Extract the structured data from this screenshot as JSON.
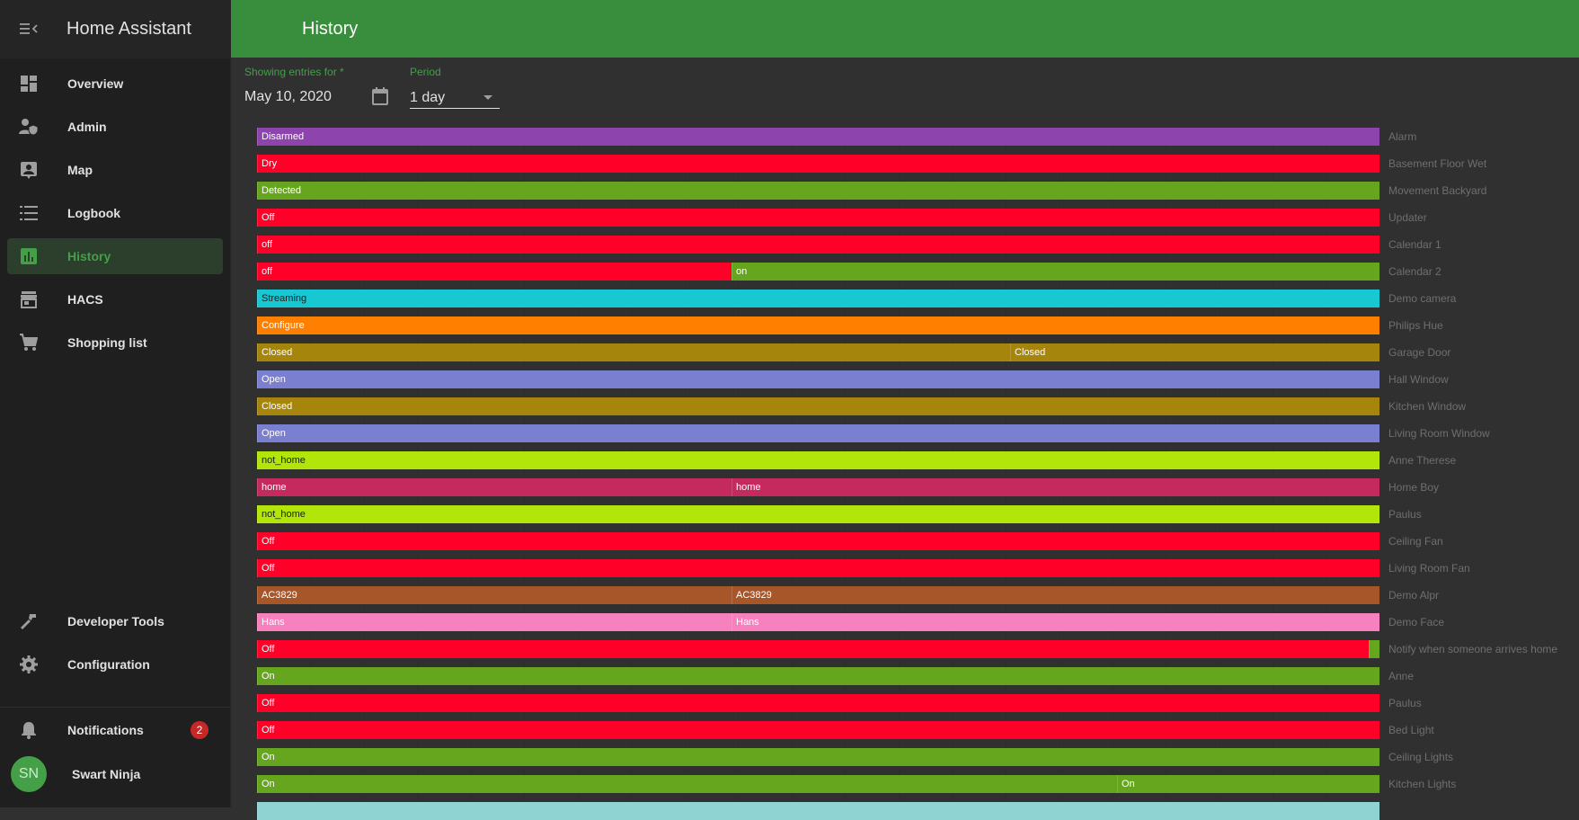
{
  "sidebar": {
    "title": "Home Assistant",
    "items": [
      {
        "label": "Overview",
        "icon": "dashboard-icon"
      },
      {
        "label": "Admin",
        "icon": "account-shield-icon"
      },
      {
        "label": "Map",
        "icon": "account-box-icon"
      },
      {
        "label": "Logbook",
        "icon": "format-list-icon"
      },
      {
        "label": "History",
        "icon": "chart-box-icon",
        "active": true
      },
      {
        "label": "HACS",
        "icon": "store-icon"
      },
      {
        "label": "Shopping list",
        "icon": "cart-icon"
      }
    ],
    "bottom_items": [
      {
        "label": "Developer Tools",
        "icon": "hammer-icon"
      },
      {
        "label": "Configuration",
        "icon": "cog-icon"
      }
    ],
    "notifications": {
      "label": "Notifications",
      "count": "2"
    },
    "user": {
      "initials": "SN",
      "name": "Swart Ninja"
    }
  },
  "header": {
    "title": "History"
  },
  "filters": {
    "date_label": "Showing entries for *",
    "date_value": "May 10, 2020",
    "period_label": "Period",
    "period_value": "1 day"
  },
  "colors": {
    "accent": "#43a047",
    "header": "#388e3c",
    "background": "#303030",
    "sidebar": "#1f1f1f"
  },
  "chart_data": {
    "type": "timeline",
    "rows": [
      {
        "entity": "Alarm",
        "segments": [
          {
            "state": "Disarmed",
            "start": 0,
            "end": 1,
            "color": "#8e44ad"
          }
        ]
      },
      {
        "entity": "Basement Floor Wet",
        "segments": [
          {
            "state": "Dry",
            "start": 0,
            "end": 1,
            "color": "#ff0029"
          }
        ]
      },
      {
        "entity": "Movement Backyard",
        "segments": [
          {
            "state": "Detected",
            "start": 0,
            "end": 1,
            "color": "#66a61e"
          }
        ]
      },
      {
        "entity": "Updater",
        "segments": [
          {
            "state": "Off",
            "start": 0,
            "end": 1,
            "color": "#ff0029"
          }
        ]
      },
      {
        "entity": "Calendar 1",
        "segments": [
          {
            "state": "off",
            "start": 0,
            "end": 1,
            "color": "#ff0029"
          }
        ]
      },
      {
        "entity": "Calendar 2",
        "segments": [
          {
            "state": "off",
            "start": 0,
            "end": 0.423,
            "color": "#ff0029"
          },
          {
            "state": "on",
            "start": 0.423,
            "end": 1,
            "color": "#66a61e"
          }
        ]
      },
      {
        "entity": "Demo camera",
        "segments": [
          {
            "state": "Streaming",
            "start": 0,
            "end": 1,
            "color": "#17c8d3"
          }
        ]
      },
      {
        "entity": "Philips Hue",
        "segments": [
          {
            "state": "Configure",
            "start": 0,
            "end": 1,
            "color": "#ff7f00"
          }
        ]
      },
      {
        "entity": "Garage Door",
        "segments": [
          {
            "state": "Closed",
            "start": 0,
            "end": 0.671,
            "color": "#a6850d"
          },
          {
            "state": "Closed",
            "start": 0.671,
            "end": 1,
            "color": "#a6850d"
          }
        ]
      },
      {
        "entity": "Hall Window",
        "segments": [
          {
            "state": "Open",
            "start": 0,
            "end": 1,
            "color": "#7b7fd0"
          }
        ]
      },
      {
        "entity": "Kitchen Window",
        "segments": [
          {
            "state": "Closed",
            "start": 0,
            "end": 1,
            "color": "#a6850d"
          }
        ]
      },
      {
        "entity": "Living Room Window",
        "segments": [
          {
            "state": "Open",
            "start": 0,
            "end": 1,
            "color": "#7b7fd0"
          }
        ]
      },
      {
        "entity": "Anne Therese",
        "segments": [
          {
            "state": "not_home",
            "start": 0,
            "end": 1,
            "color": "#b2e60b"
          }
        ]
      },
      {
        "entity": "Home Boy",
        "segments": [
          {
            "state": "home",
            "start": 0,
            "end": 0.423,
            "color": "#c42a5e"
          },
          {
            "state": "home",
            "start": 0.423,
            "end": 1,
            "color": "#c42a5e"
          }
        ]
      },
      {
        "entity": "Paulus",
        "segments": [
          {
            "state": "not_home",
            "start": 0,
            "end": 1,
            "color": "#b2e60b"
          }
        ]
      },
      {
        "entity": "Ceiling Fan",
        "segments": [
          {
            "state": "Off",
            "start": 0,
            "end": 1,
            "color": "#ff0029"
          }
        ]
      },
      {
        "entity": "Living Room Fan",
        "segments": [
          {
            "state": "Off",
            "start": 0,
            "end": 1,
            "color": "#ff0029"
          }
        ]
      },
      {
        "entity": "Demo Alpr",
        "segments": [
          {
            "state": "AC3829",
            "start": 0,
            "end": 0.423,
            "color": "#a65628"
          },
          {
            "state": "AC3829",
            "start": 0.423,
            "end": 1,
            "color": "#a65628"
          }
        ]
      },
      {
        "entity": "Demo Face",
        "segments": [
          {
            "state": "Hans",
            "start": 0,
            "end": 0.423,
            "color": "#f781bf"
          },
          {
            "state": "Hans",
            "start": 0.423,
            "end": 1,
            "color": "#f781bf"
          }
        ]
      },
      {
        "entity": "Notify when someone arrives home",
        "segments": [
          {
            "state": "Off",
            "start": 0,
            "end": 0.99,
            "color": "#ff0029"
          },
          {
            "state": "",
            "start": 0.99,
            "end": 1,
            "color": "#66a61e"
          }
        ]
      },
      {
        "entity": "Anne",
        "segments": [
          {
            "state": "On",
            "start": 0,
            "end": 1,
            "color": "#66a61e"
          }
        ]
      },
      {
        "entity": "Paulus",
        "segments": [
          {
            "state": "Off",
            "start": 0,
            "end": 1,
            "color": "#ff0029"
          }
        ]
      },
      {
        "entity": "Bed Light",
        "segments": [
          {
            "state": "Off",
            "start": 0,
            "end": 1,
            "color": "#ff0029"
          }
        ]
      },
      {
        "entity": "Ceiling Lights",
        "segments": [
          {
            "state": "On",
            "start": 0,
            "end": 1,
            "color": "#66a61e"
          }
        ]
      },
      {
        "entity": "Kitchen Lights",
        "segments": [
          {
            "state": "On",
            "start": 0,
            "end": 0.766,
            "color": "#66a61e"
          },
          {
            "state": "On",
            "start": 0.766,
            "end": 1,
            "color": "#66a61e"
          }
        ]
      },
      {
        "entity": "",
        "segments": [
          {
            "state": "",
            "start": 0,
            "end": 1,
            "color": "#8fd3d3"
          }
        ]
      }
    ]
  }
}
